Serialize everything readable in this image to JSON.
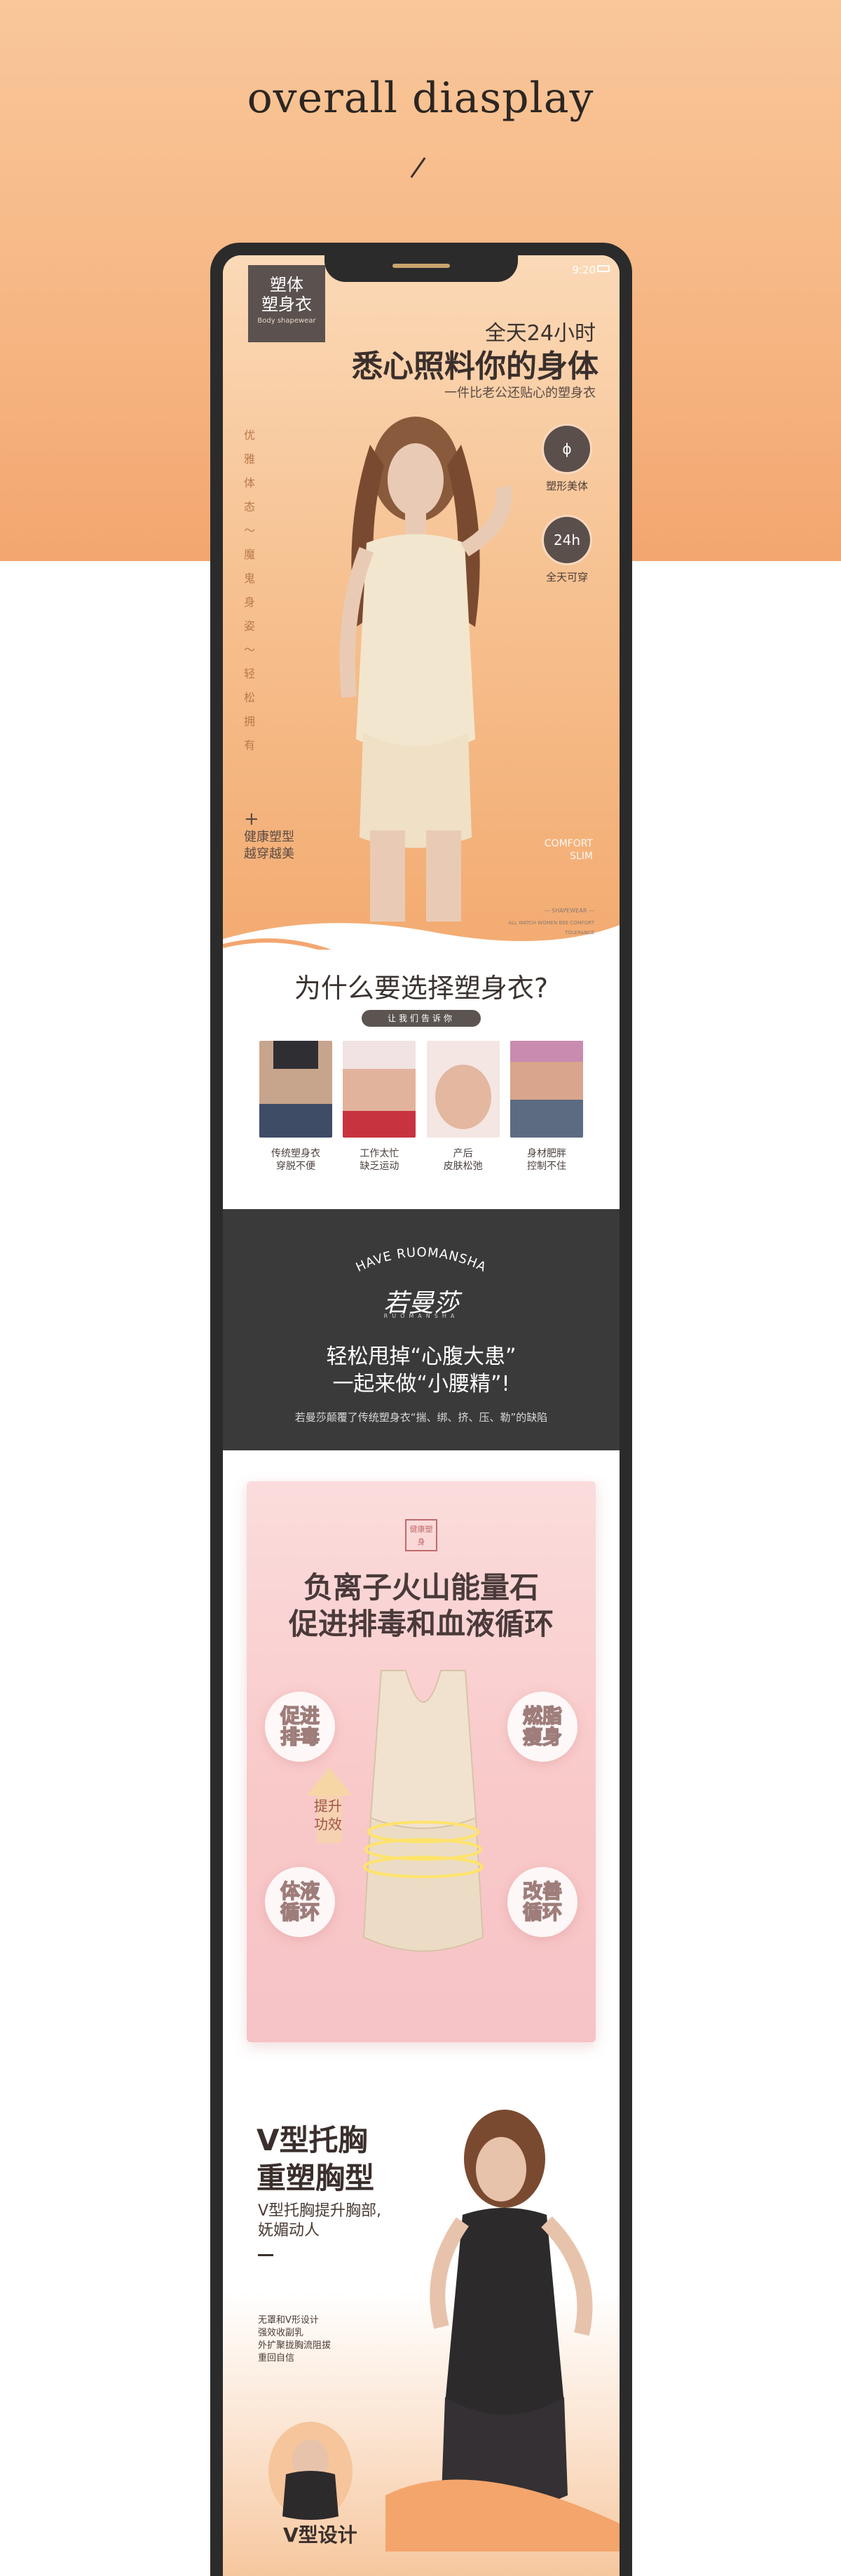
{
  "page": {
    "headline": "overall diasplay"
  },
  "status": {
    "time": "9:20"
  },
  "hero": {
    "logo_line1": "塑体",
    "logo_line2": "塑身衣",
    "logo_en": "Body shapewear",
    "subtitle1": "全天24小时",
    "title": "悉心照料你的身体",
    "subtitle2": "一件比老公还贴心的塑身衣",
    "vertical_text": "优雅体态～魔鬼身姿～轻松拥有",
    "features": [
      {
        "icon": "ϕ",
        "caption": "塑形美体"
      },
      {
        "icon": "24h",
        "caption": "全天可穿"
      }
    ],
    "health_plus": "+",
    "health_l1": "健康塑型",
    "health_l2": "越穿越美",
    "comfort_l1": "COMFORT",
    "comfort_l2": "SLIM",
    "tiny1": "— SHAPEWEAR —",
    "tiny2": "ALL WATCH WOMEN BEE COMFORT",
    "tiny3": "TOLERANCE"
  },
  "why": {
    "title": "为什么要选择塑身衣?",
    "pill": "让我们告诉你",
    "items": [
      {
        "line1": "传统塑身衣",
        "line2": "穿脱不便"
      },
      {
        "line1": "工作太忙",
        "line2": "缺乏运动"
      },
      {
        "line1": "产后",
        "line2": "皮肤松弛"
      },
      {
        "line1": "身材肥胖",
        "line2": "控制不住"
      }
    ]
  },
  "dark": {
    "arc": "HAVE RUOMANSHA",
    "brand_cn": "若曼莎",
    "brand_en": "RUOMANSHA",
    "line1": "轻松甩掉“心腹大患”",
    "line2": "一起来做“小腰精”!",
    "line3": "若曼莎颠覆了传统塑身衣“揣、绑、挤、压、勒”的缺陷"
  },
  "pink": {
    "badge": "健康塑身",
    "h1": "负离子火山能量石",
    "h2": "促进排毒和血液循环",
    "bubbles": [
      {
        "l1": "促进",
        "l2": "排毒"
      },
      {
        "l1": "燃脂",
        "l2": "瘦身"
      },
      {
        "l1": "体液",
        "l2": "循环"
      },
      {
        "l1": "改善",
        "l2": "循环"
      }
    ],
    "boost_l1": "提升",
    "boost_l2": "功效"
  },
  "vsec": {
    "t1": "V型托胸",
    "t2": "重塑胸型",
    "s1": "V型托胸提升胸部,",
    "s2": "妩媚动人",
    "small1": "无罩和V形设计",
    "small2": "强效收副乳",
    "small3": "外扩聚拢胸流阻拔",
    "small4": "重回自信",
    "design": "V型设计"
  },
  "colors": {
    "band": "#f6b582",
    "phone": "#2b2b2b",
    "dark_section": "#3a3a3a",
    "pink_card": "#f9c9c9"
  }
}
